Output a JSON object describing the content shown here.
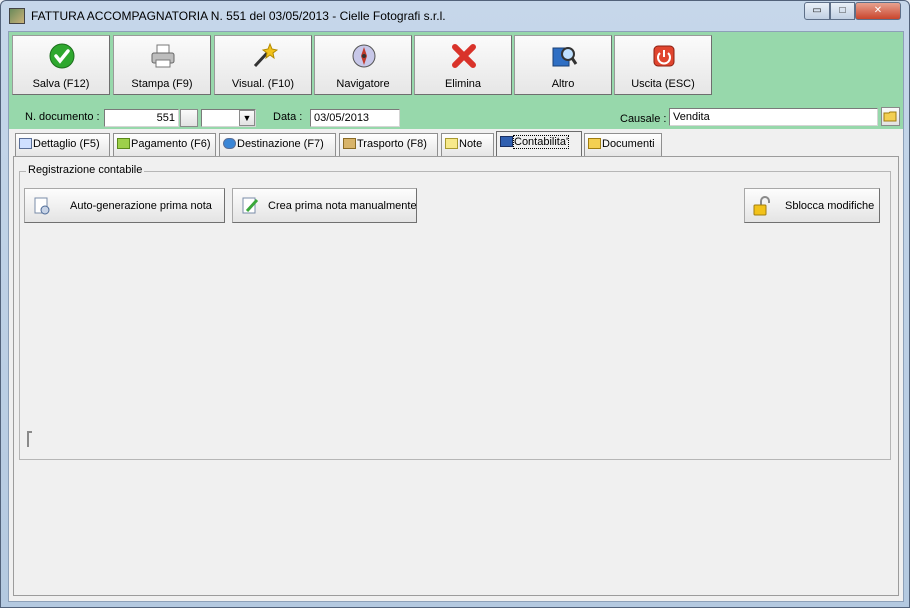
{
  "window": {
    "title": "FATTURA ACCOMPAGNATORIA N. 551 del 03/05/2013 - Cielle Fotografi s.r.l.",
    "controls": {
      "minimize": "▭",
      "maximize": "□",
      "close": "✕"
    }
  },
  "toolbar": {
    "buttons": [
      {
        "label": "Salva (F12)",
        "icon": "check-icon"
      },
      {
        "label": "Stampa (F9)",
        "icon": "printer-icon"
      },
      {
        "label": "Visual. (F10)",
        "icon": "magic-wand-icon"
      },
      {
        "label": "Navigatore",
        "icon": "compass-icon"
      },
      {
        "label": "Elimina",
        "icon": "red-x-icon"
      },
      {
        "label": "Altro",
        "icon": "magnifier-book-icon"
      },
      {
        "label": "Uscita (ESC)",
        "icon": "power-icon"
      }
    ],
    "colors": {
      "background": "#97d8ab"
    }
  },
  "header": {
    "doc_number_label": "N. documento :",
    "doc_number_value": "551",
    "suffix_value": "",
    "date_label": "Data :",
    "date_value": "03/05/2013",
    "causale_label": "Causale :",
    "causale_value": "Vendita"
  },
  "tabs": [
    {
      "label": "Dettaglio (F5)",
      "icon": "table-icon"
    },
    {
      "label": "Pagamento (F6)",
      "icon": "money-icon"
    },
    {
      "label": "Destinazione (F7)",
      "icon": "globe-icon"
    },
    {
      "label": "Trasporto (F8)",
      "icon": "truck-icon"
    },
    {
      "label": "Note",
      "icon": "note-icon"
    },
    {
      "label": "Contabilita'",
      "icon": "book-icon",
      "active": true
    },
    {
      "label": "Documenti",
      "icon": "folder-icon"
    }
  ],
  "panel": {
    "group_title": "Registrazione contabile",
    "auto_button": "Auto-generazione prima nota",
    "manual_button": "Crea prima nota manualmente",
    "unlock_button": "Sblocca modifiche"
  }
}
